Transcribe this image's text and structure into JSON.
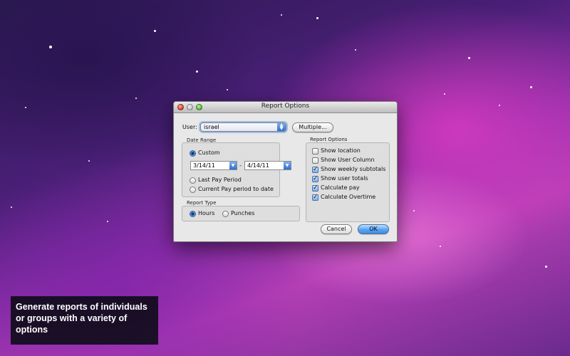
{
  "window": {
    "title": "Report Options"
  },
  "user": {
    "label": "User:",
    "selected": "israel",
    "multiple_button": "Multiple..."
  },
  "date_range": {
    "heading": "Date Range",
    "options": [
      "Custom",
      "Last Pay Period",
      "Current Pay period to date"
    ],
    "selected": "Custom",
    "start_date": "3/14/11",
    "separator": "-",
    "end_date": "4/14/11"
  },
  "report_type": {
    "heading": "Report Type",
    "options": [
      "Hours",
      "Punches"
    ],
    "selected": "Hours"
  },
  "report_options": {
    "heading": "Report Options",
    "items": [
      {
        "label": "Show location",
        "checked": false
      },
      {
        "label": "Show User Column",
        "checked": false
      },
      {
        "label": "Show weekly subtotals",
        "checked": true
      },
      {
        "label": "Show user totals",
        "checked": true
      },
      {
        "label": "Calculate pay",
        "checked": true
      },
      {
        "label": "Calculate Overtime",
        "checked": true
      }
    ]
  },
  "buttons": {
    "cancel": "Cancel",
    "ok": "OK"
  },
  "caption": "Generate reports of individuals or groups with a variety of options",
  "colors": {
    "accent": "#3f8ae0",
    "caption_bg": "#0a0a14"
  }
}
